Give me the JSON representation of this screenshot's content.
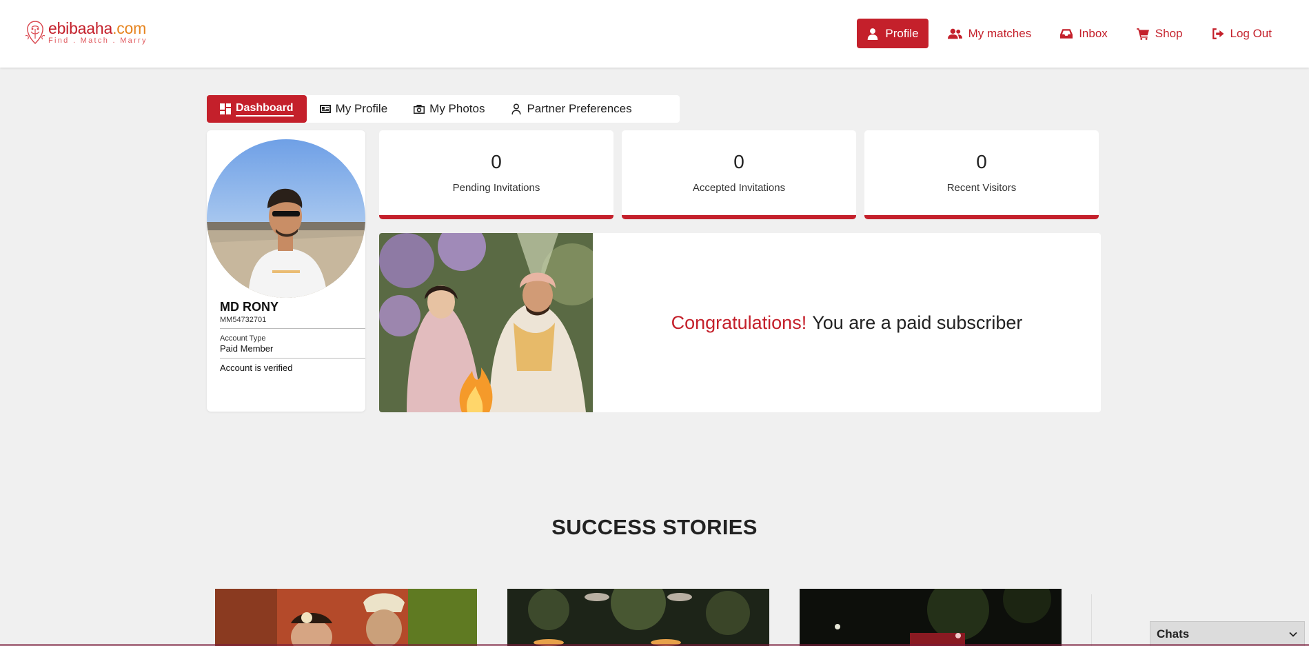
{
  "brand": {
    "name_main": "ebibaaha",
    "name_suffix": ".com",
    "tagline": "Find . Match . Marry",
    "accent_color": "#c4202b"
  },
  "nav": [
    {
      "label": "Profile",
      "icon": "user-icon",
      "active": true
    },
    {
      "label": "My matches",
      "icon": "users-icon",
      "active": false
    },
    {
      "label": "Inbox",
      "icon": "inbox-icon",
      "active": false
    },
    {
      "label": "Shop",
      "icon": "cart-icon",
      "active": false
    },
    {
      "label": "Log Out",
      "icon": "logout-icon",
      "active": false
    }
  ],
  "tabs": [
    {
      "label": "Dashboard",
      "icon": "dashboard-icon",
      "active": true
    },
    {
      "label": "My Profile",
      "icon": "id-card-icon",
      "active": false
    },
    {
      "label": "My Photos",
      "icon": "camera-icon",
      "active": false
    },
    {
      "label": "Partner Preferences",
      "icon": "person-icon",
      "active": false
    }
  ],
  "profile": {
    "name": "MD RONY",
    "id": "MM54732701",
    "account_type_label": "Account Type",
    "account_type": "Paid Member",
    "verification": "Account is verified"
  },
  "stats": [
    {
      "value": "0",
      "label": "Pending Invitations"
    },
    {
      "value": "0",
      "label": "Accepted Invitations"
    },
    {
      "value": "0",
      "label": "Recent Visitors"
    }
  ],
  "subscription": {
    "highlight": "Congratulations!",
    "message": "You are a paid subscriber"
  },
  "success_stories": {
    "title": "SUCCESS STORIES"
  },
  "chats": {
    "label": "Chats"
  }
}
